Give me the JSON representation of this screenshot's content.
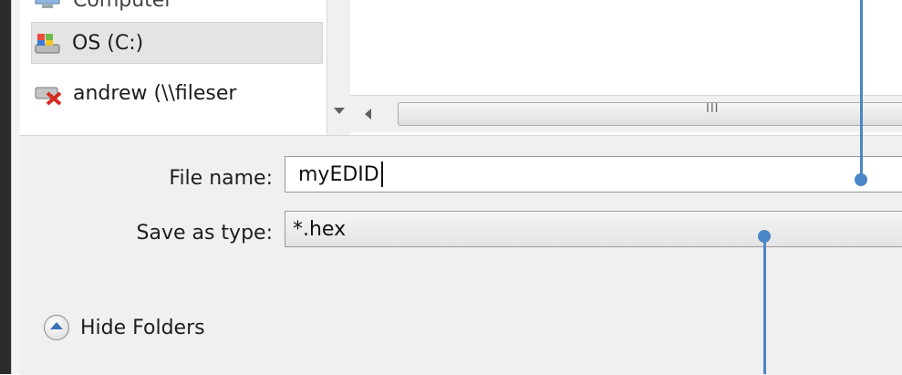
{
  "nav_tree": {
    "items": [
      {
        "label": "Computer",
        "icon": "computer-icon"
      },
      {
        "label": "OS (C:)",
        "icon": "drive-icon",
        "selected": true
      },
      {
        "label": "andrew (\\\\fileser",
        "icon": "network-drive-disconnected-icon"
      }
    ]
  },
  "hscroll": {
    "grip": "III"
  },
  "form": {
    "filename_label": "File name:",
    "filename_value": "myEDID",
    "type_label": "Save as type:",
    "type_value": "*.hex"
  },
  "hide_folders": {
    "label": "Hide Folders"
  },
  "colors": {
    "callout": "#4a86c5",
    "panel": "#f0f0f0"
  }
}
